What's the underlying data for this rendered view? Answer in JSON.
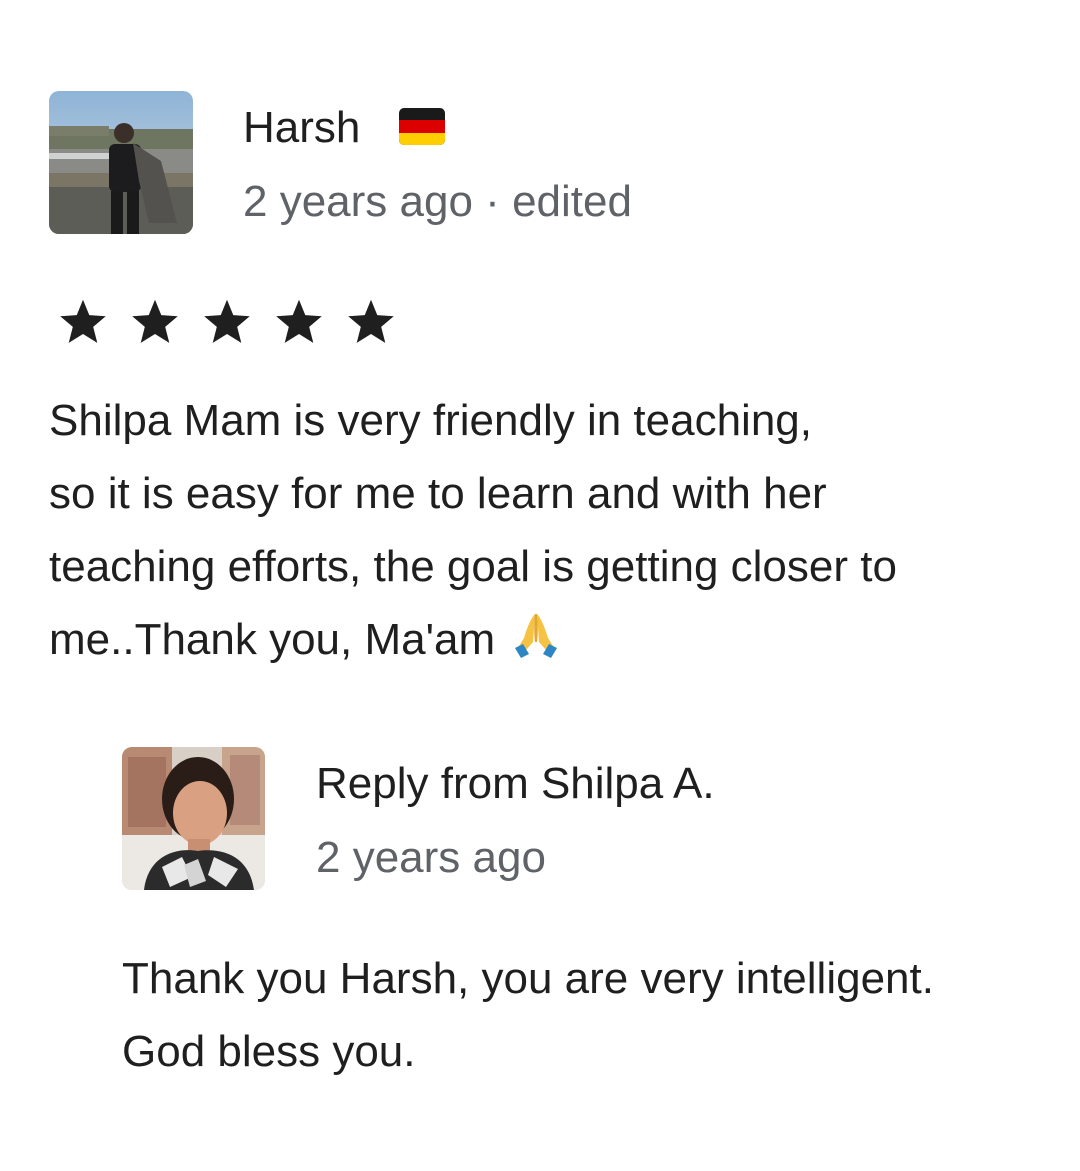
{
  "review": {
    "reviewer": {
      "name": "Harsh",
      "flag_icon": "germany-flag-icon",
      "avatar": "harsh-avatar"
    },
    "time": "2 years ago",
    "separator": "·",
    "edited_label": "edited",
    "rating": {
      "stars": 5,
      "max": 5,
      "color": "#1f1f1f"
    },
    "text_lines": [
      "Shilpa Mam is very friendly in teaching,",
      "so it is easy for me to learn and with her",
      "teaching efforts, the goal is getting closer to",
      "me..Thank you, Ma'am"
    ],
    "emoji": "folded-hands-icon"
  },
  "reply": {
    "title": "Reply from Shilpa A.",
    "time": "2 years ago",
    "avatar": "shilpa-avatar",
    "text_lines": [
      "Thank you Harsh, you are very intelligent.",
      "God bless you."
    ]
  },
  "colors": {
    "primary_text": "#1f1f1f",
    "secondary_text": "#5f6368",
    "background": "#ffffff"
  }
}
